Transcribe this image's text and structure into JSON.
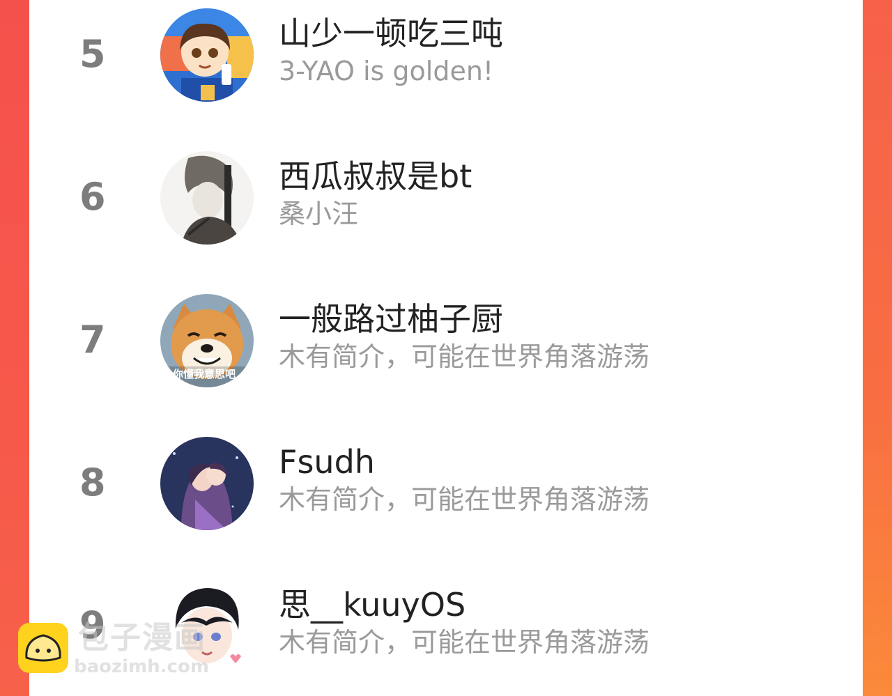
{
  "colors": {
    "left_border": "#f5514c",
    "right_border": "#f86d42",
    "rank": "#7d7d7d",
    "name": "#222222",
    "desc": "#9a9a9a"
  },
  "ranking": [
    {
      "rank": "5",
      "name": "山少一顿吃三吨",
      "desc": "3-YAO is golden!",
      "avatar": "cartoon-boy-avatar"
    },
    {
      "rank": "6",
      "name": "西瓜叔叔是bt",
      "desc": "桑小汪",
      "avatar": "sketch-man-avatar"
    },
    {
      "rank": "7",
      "name": "一般路过柚子厨",
      "desc": "木有简介，可能在世界角落游荡",
      "avatar": "shiba-dog-avatar",
      "avatar_caption": "你懂我意思吧"
    },
    {
      "rank": "8",
      "name": "Fsudh",
      "desc": "木有简介，可能在世界角落游荡",
      "avatar": "anime-couple-avatar"
    },
    {
      "rank": "9",
      "name": "思__kuuyOS",
      "desc": "木有简介，可能在世界角落游荡",
      "avatar": "anime-boy-avatar"
    }
  ],
  "watermark": {
    "title": "包子漫画",
    "url": "baozimh.com",
    "logo_icon": "bun-logo-icon"
  }
}
